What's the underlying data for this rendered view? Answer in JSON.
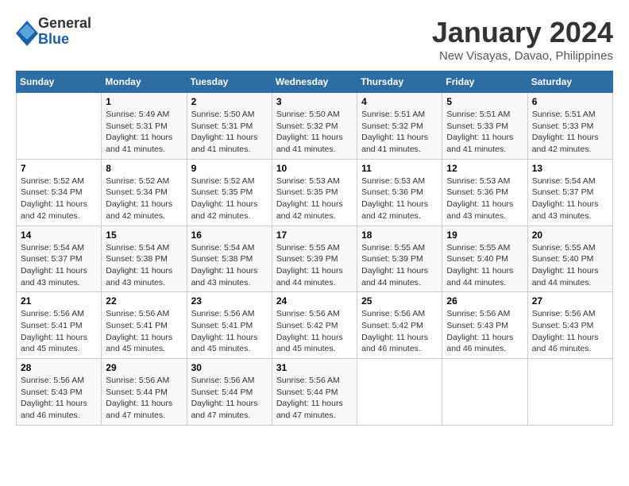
{
  "header": {
    "logo": {
      "general": "General",
      "blue": "Blue"
    },
    "title": "January 2024",
    "location": "New Visayas, Davao, Philippines"
  },
  "weekdays": [
    "Sunday",
    "Monday",
    "Tuesday",
    "Wednesday",
    "Thursday",
    "Friday",
    "Saturday"
  ],
  "weeks": [
    [
      {
        "day": "",
        "info": ""
      },
      {
        "day": "1",
        "info": "Sunrise: 5:49 AM\nSunset: 5:31 PM\nDaylight: 11 hours and 41 minutes."
      },
      {
        "day": "2",
        "info": "Sunrise: 5:50 AM\nSunset: 5:31 PM\nDaylight: 11 hours and 41 minutes."
      },
      {
        "day": "3",
        "info": "Sunrise: 5:50 AM\nSunset: 5:32 PM\nDaylight: 11 hours and 41 minutes."
      },
      {
        "day": "4",
        "info": "Sunrise: 5:51 AM\nSunset: 5:32 PM\nDaylight: 11 hours and 41 minutes."
      },
      {
        "day": "5",
        "info": "Sunrise: 5:51 AM\nSunset: 5:33 PM\nDaylight: 11 hours and 41 minutes."
      },
      {
        "day": "6",
        "info": "Sunrise: 5:51 AM\nSunset: 5:33 PM\nDaylight: 11 hours and 42 minutes."
      }
    ],
    [
      {
        "day": "7",
        "info": "Sunrise: 5:52 AM\nSunset: 5:34 PM\nDaylight: 11 hours and 42 minutes."
      },
      {
        "day": "8",
        "info": "Sunrise: 5:52 AM\nSunset: 5:34 PM\nDaylight: 11 hours and 42 minutes."
      },
      {
        "day": "9",
        "info": "Sunrise: 5:52 AM\nSunset: 5:35 PM\nDaylight: 11 hours and 42 minutes."
      },
      {
        "day": "10",
        "info": "Sunrise: 5:53 AM\nSunset: 5:35 PM\nDaylight: 11 hours and 42 minutes."
      },
      {
        "day": "11",
        "info": "Sunrise: 5:53 AM\nSunset: 5:36 PM\nDaylight: 11 hours and 42 minutes."
      },
      {
        "day": "12",
        "info": "Sunrise: 5:53 AM\nSunset: 5:36 PM\nDaylight: 11 hours and 43 minutes."
      },
      {
        "day": "13",
        "info": "Sunrise: 5:54 AM\nSunset: 5:37 PM\nDaylight: 11 hours and 43 minutes."
      }
    ],
    [
      {
        "day": "14",
        "info": "Sunrise: 5:54 AM\nSunset: 5:37 PM\nDaylight: 11 hours and 43 minutes."
      },
      {
        "day": "15",
        "info": "Sunrise: 5:54 AM\nSunset: 5:38 PM\nDaylight: 11 hours and 43 minutes."
      },
      {
        "day": "16",
        "info": "Sunrise: 5:54 AM\nSunset: 5:38 PM\nDaylight: 11 hours and 43 minutes."
      },
      {
        "day": "17",
        "info": "Sunrise: 5:55 AM\nSunset: 5:39 PM\nDaylight: 11 hours and 44 minutes."
      },
      {
        "day": "18",
        "info": "Sunrise: 5:55 AM\nSunset: 5:39 PM\nDaylight: 11 hours and 44 minutes."
      },
      {
        "day": "19",
        "info": "Sunrise: 5:55 AM\nSunset: 5:40 PM\nDaylight: 11 hours and 44 minutes."
      },
      {
        "day": "20",
        "info": "Sunrise: 5:55 AM\nSunset: 5:40 PM\nDaylight: 11 hours and 44 minutes."
      }
    ],
    [
      {
        "day": "21",
        "info": "Sunrise: 5:56 AM\nSunset: 5:41 PM\nDaylight: 11 hours and 45 minutes."
      },
      {
        "day": "22",
        "info": "Sunrise: 5:56 AM\nSunset: 5:41 PM\nDaylight: 11 hours and 45 minutes."
      },
      {
        "day": "23",
        "info": "Sunrise: 5:56 AM\nSunset: 5:41 PM\nDaylight: 11 hours and 45 minutes."
      },
      {
        "day": "24",
        "info": "Sunrise: 5:56 AM\nSunset: 5:42 PM\nDaylight: 11 hours and 45 minutes."
      },
      {
        "day": "25",
        "info": "Sunrise: 5:56 AM\nSunset: 5:42 PM\nDaylight: 11 hours and 46 minutes."
      },
      {
        "day": "26",
        "info": "Sunrise: 5:56 AM\nSunset: 5:43 PM\nDaylight: 11 hours and 46 minutes."
      },
      {
        "day": "27",
        "info": "Sunrise: 5:56 AM\nSunset: 5:43 PM\nDaylight: 11 hours and 46 minutes."
      }
    ],
    [
      {
        "day": "28",
        "info": "Sunrise: 5:56 AM\nSunset: 5:43 PM\nDaylight: 11 hours and 46 minutes."
      },
      {
        "day": "29",
        "info": "Sunrise: 5:56 AM\nSunset: 5:44 PM\nDaylight: 11 hours and 47 minutes."
      },
      {
        "day": "30",
        "info": "Sunrise: 5:56 AM\nSunset: 5:44 PM\nDaylight: 11 hours and 47 minutes."
      },
      {
        "day": "31",
        "info": "Sunrise: 5:56 AM\nSunset: 5:44 PM\nDaylight: 11 hours and 47 minutes."
      },
      {
        "day": "",
        "info": ""
      },
      {
        "day": "",
        "info": ""
      },
      {
        "day": "",
        "info": ""
      }
    ]
  ]
}
